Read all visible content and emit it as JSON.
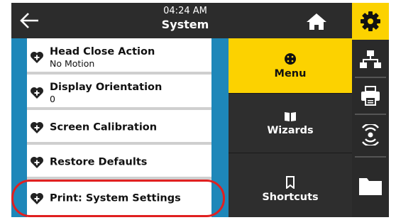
{
  "header": {
    "time": "04:24 AM",
    "title": "System"
  },
  "list": {
    "items": [
      {
        "title": "Head Close Action",
        "subtitle": "No Motion"
      },
      {
        "title": "Display Orientation",
        "subtitle": "0"
      },
      {
        "title": "Screen Calibration",
        "subtitle": ""
      },
      {
        "title": "Restore Defaults",
        "subtitle": ""
      },
      {
        "title": "Print: System Settings",
        "subtitle": ""
      }
    ]
  },
  "middle_tabs": [
    {
      "label": "Menu",
      "icon": "menu-dots-icon",
      "active": true
    },
    {
      "label": "Wizards",
      "icon": "book-icon",
      "active": false
    },
    {
      "label": "Shortcuts",
      "icon": "bookmark-icon",
      "active": false
    }
  ],
  "right_icons": [
    {
      "icon": "gear-icon",
      "active": true
    },
    {
      "icon": "network-icon",
      "active": false
    },
    {
      "icon": "printer-icon",
      "active": false
    },
    {
      "icon": "wireless-icon",
      "active": false
    },
    {
      "icon": "folder-icon",
      "active": false
    }
  ],
  "colors": {
    "accent": "#fcd200",
    "stripe": "#1e87b9",
    "dark": "#2c2c2c",
    "highlight": "#e02020"
  }
}
